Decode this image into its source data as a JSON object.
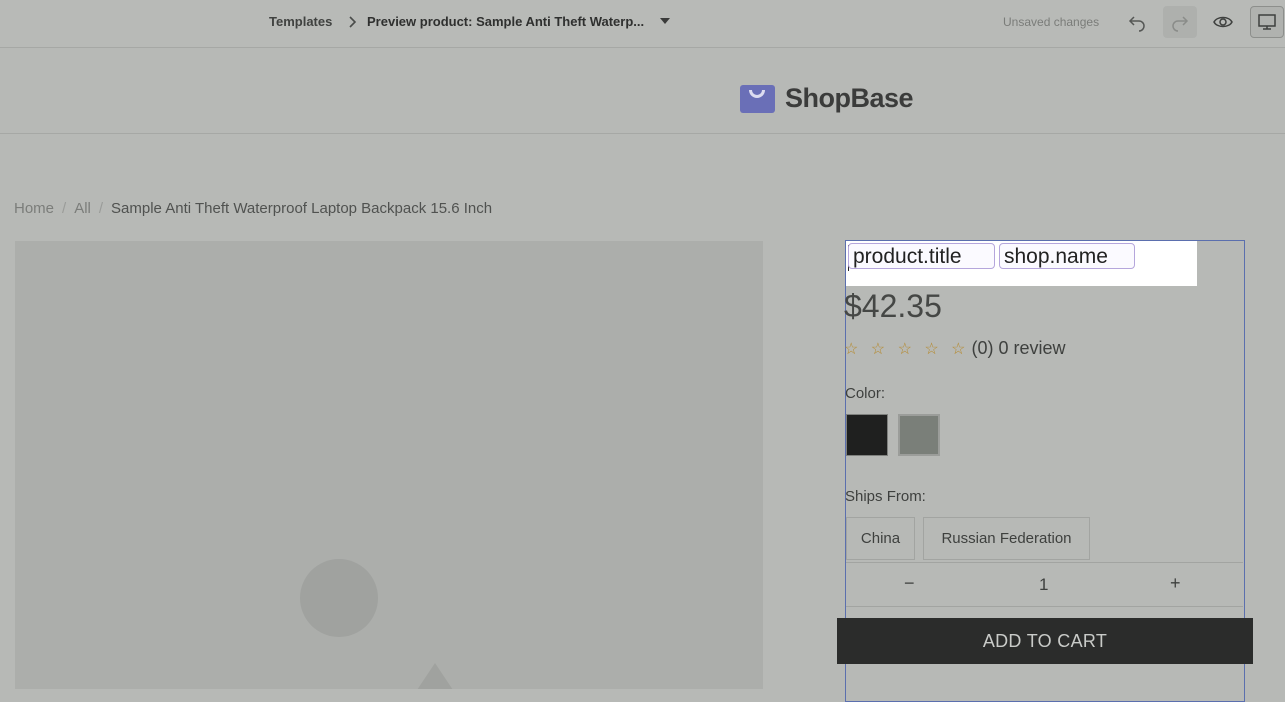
{
  "editor": {
    "breadcrumb_root": "Templates",
    "breadcrumb_current": "Preview product: Sample Anti Theft Waterp...",
    "status": "Unsaved changes"
  },
  "icons": {
    "separator": "chevron-right-icon",
    "dropdown": "caret-down-icon",
    "undo": "undo-icon",
    "redo": "redo-icon",
    "preview": "eye-icon",
    "device": "desktop-icon"
  },
  "store": {
    "logo_text": "ShopBase",
    "brand_color": "#6a6fb7"
  },
  "breadcrumb": {
    "home": "Home",
    "sep": "/",
    "all": "All",
    "current": "Sample Anti Theft Waterproof Laptop Backpack 15.6 Inch"
  },
  "product": {
    "title_token_1": "product.title",
    "title_token_2": "shop.name",
    "price": "$42.35",
    "stars": "☆ ☆ ☆ ☆ ☆",
    "review_text": "(0) 0 review",
    "color_label": "Color:",
    "colors": [
      "#1f201f",
      "#7a7f79"
    ],
    "ships_label": "Ships From:",
    "ships_options": [
      "China",
      "Russian Federation"
    ],
    "qty_minus": "−",
    "qty_value": "1",
    "qty_plus": "+",
    "add_to_cart": "ADD TO CART"
  }
}
